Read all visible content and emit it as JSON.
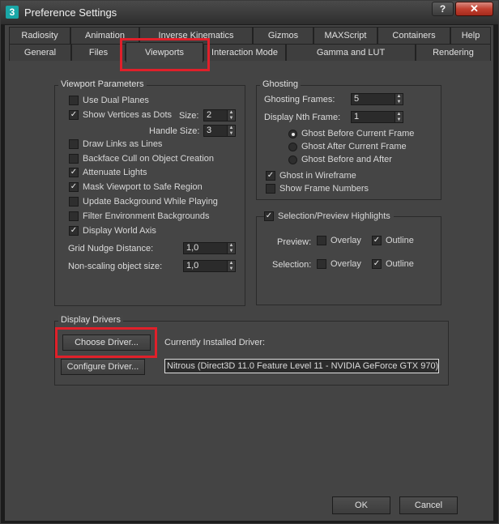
{
  "window": {
    "title": "Preference Settings",
    "app_icon": "3ds-max-logo",
    "help_label": "?",
    "close_label": "✕"
  },
  "tabs_row1": [
    "Radiosity",
    "Animation",
    "Inverse Kinematics",
    "Gizmos",
    "MAXScript",
    "Containers",
    "Help"
  ],
  "tabs_row2": [
    "General",
    "Files",
    "Viewports",
    "Interaction Mode",
    "Gamma and LUT",
    "Rendering"
  ],
  "active_tab": "Viewports",
  "viewport_params": {
    "title": "Viewport Parameters",
    "use_dual_planes": "Use Dual Planes",
    "show_vertices": "Show Vertices as Dots",
    "size_label": "Size:",
    "size_value": "2",
    "handle_size_label": "Handle Size:",
    "handle_size_value": "3",
    "draw_links": "Draw Links as Lines",
    "backface_cull": "Backface Cull on Object Creation",
    "attenuate_lights": "Attenuate Lights",
    "mask_viewport": "Mask Viewport to Safe Region",
    "update_background": "Update Background While Playing",
    "filter_env": "Filter Environment Backgrounds",
    "display_world_axis": "Display World Axis",
    "grid_nudge_label": "Grid Nudge Distance:",
    "grid_nudge_value": "1,0",
    "non_scaling_label": "Non-scaling object size:",
    "non_scaling_value": "1,0"
  },
  "ghosting": {
    "title": "Ghosting",
    "frames_label": "Ghosting Frames:",
    "frames_value": "5",
    "nth_label": "Display Nth Frame:",
    "nth_value": "1",
    "before": "Ghost Before Current Frame",
    "after": "Ghost After Current Frame",
    "before_after": "Ghost Before and After",
    "wireframe": "Ghost in Wireframe",
    "frame_numbers": "Show Frame Numbers"
  },
  "highlights": {
    "title": "Selection/Preview Highlights",
    "preview_label": "Preview:",
    "selection_label": "Selection:",
    "overlay": "Overlay",
    "outline": "Outline"
  },
  "display_drivers": {
    "title": "Display Drivers",
    "choose": "Choose Driver...",
    "configure": "Configure Driver...",
    "installed_label": "Currently Installed Driver:",
    "installed_value": "Nitrous (Direct3D 11.0 Feature Level 11 - NVIDIA GeForce GTX 970)"
  },
  "buttons": {
    "ok": "OK",
    "cancel": "Cancel"
  },
  "colors": {
    "highlight": "#e0202a",
    "panel": "#454545",
    "background": "#1c1c1c"
  }
}
